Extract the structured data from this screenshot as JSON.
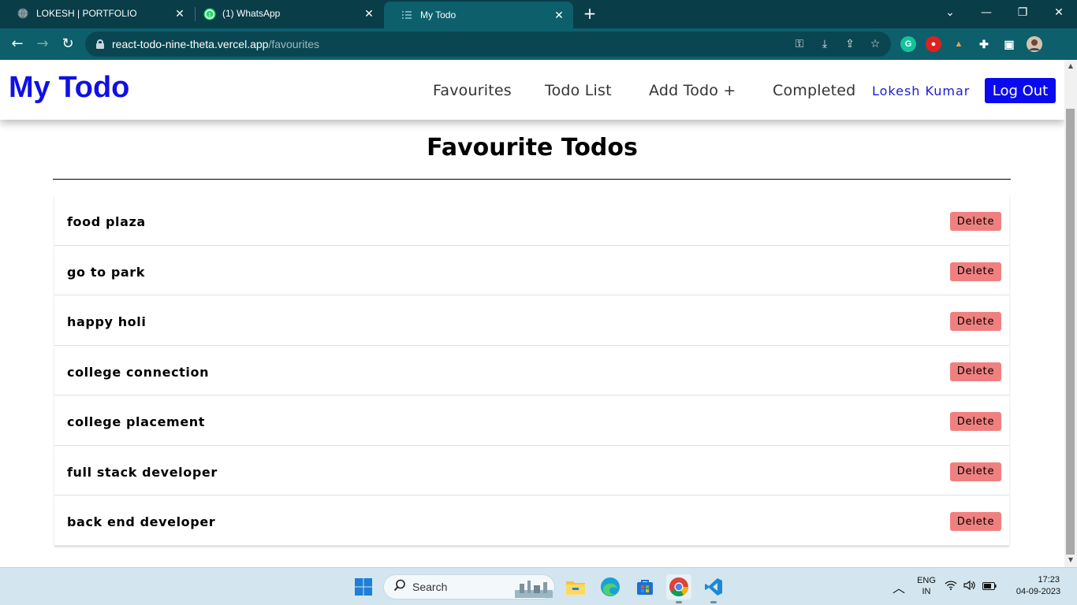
{
  "browser": {
    "tabs": [
      {
        "title": "LOKESH | PORTFOLIO",
        "active": false
      },
      {
        "title": "(1) WhatsApp",
        "active": false
      },
      {
        "title": "My Todo",
        "active": true
      }
    ],
    "url_host": "react-todo-nine-theta.vercel.app",
    "url_path": "/favourites"
  },
  "app": {
    "brand": "My Todo",
    "nav": [
      "Favourites",
      "Todo List",
      "Add Todo +",
      "Completed"
    ],
    "user_name": "Lokesh Kumar",
    "logout_label": "Log Out"
  },
  "main": {
    "heading": "Favourite Todos",
    "delete_label": "Delete",
    "todos": [
      "food plaza",
      "go to park",
      "happy holi",
      "college connection",
      "college placement",
      "full stack developer",
      "back end developer"
    ]
  },
  "taskbar": {
    "search_label": "Search",
    "lang_top": "ENG",
    "lang_bottom": "IN",
    "time": "17:23",
    "date": "04-09-2023"
  },
  "colors": {
    "brand": "#1010e6",
    "logout_bg": "#0a0aee",
    "delete_bg": "#f08080",
    "chrome_dark": "#093d48",
    "chrome_toolbar": "#0d5f6c"
  }
}
